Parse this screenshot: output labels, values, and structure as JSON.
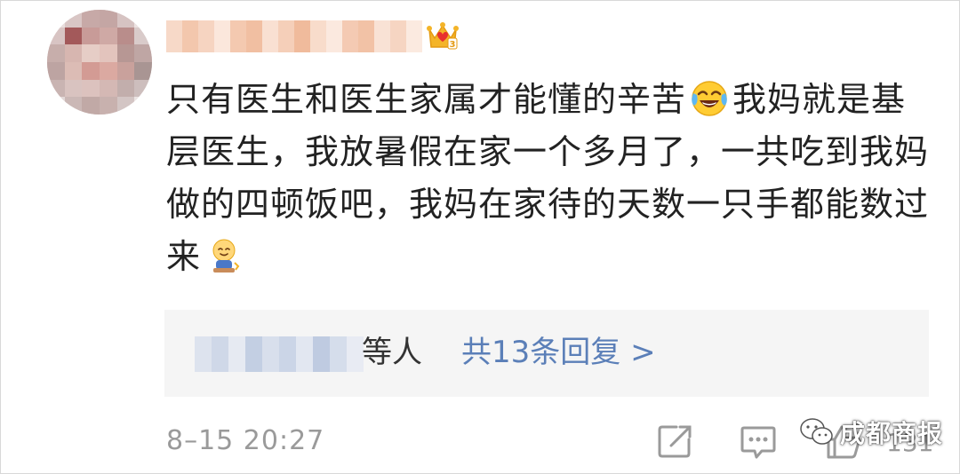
{
  "comment": {
    "username": "",
    "badge_icon": "crown-badge-icon",
    "text_segments": [
      "只有医生和医生家属才能懂的辛苦",
      "我妈就是基层医生，我放暑假在家一个多月了，一共吃到我妈做的四顿饭吧，我妈在家待的天数一只手都能数过来"
    ],
    "emoji_1": "crying-laughing-emoji",
    "emoji_2": "sweat-smile-emoji",
    "timestamp": "8–15 20:27"
  },
  "replies": {
    "suffix": "等人",
    "link_label": "共13条回复 >"
  },
  "actions": {
    "share_icon": "share-icon",
    "comment_icon": "comment-icon",
    "like_icon": "like-icon",
    "like_count": "131"
  },
  "watermark": {
    "icon": "wechat-icon",
    "text": "成都商报"
  },
  "colors": {
    "text": "#222222",
    "link": "#5b7fb8",
    "meta": "#9a9a9a",
    "reply_bg": "#f5f5f5"
  }
}
